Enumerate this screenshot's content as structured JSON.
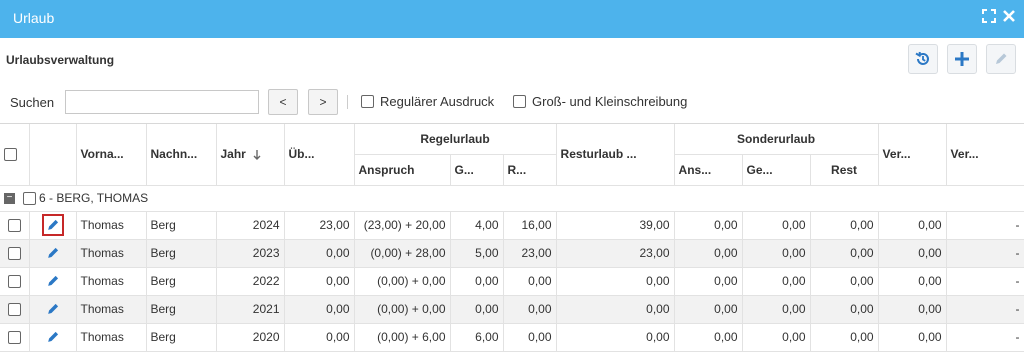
{
  "window": {
    "title": "Urlaub"
  },
  "section": {
    "title": "Urlaubsverwaltung"
  },
  "search": {
    "label": "Suchen",
    "value": "",
    "prev_label": "<",
    "next_label": ">"
  },
  "options": {
    "regular_print": "Regulärer Ausdruck",
    "case_sensitive": "Groß- und Kleinschreibung"
  },
  "columns": {
    "vorname": "Vorna...",
    "nachname": "Nachn...",
    "jahr": "Jahr",
    "ueb": "Üb...",
    "regelurlaub": "Regelurlaub",
    "anspruch": "Anspruch",
    "genommen": "G...",
    "rest": "R...",
    "resturlaub": "Resturlaub ...",
    "sonderurlaub": "Sonderurlaub",
    "s_anspruch": "Ans...",
    "s_genommen": "Ge...",
    "s_rest": "Rest",
    "ver1": "Ver...",
    "ver2": "Ver..."
  },
  "group": {
    "label": "6 - BERG, THOMAS"
  },
  "rows": [
    {
      "vorname": "Thomas",
      "nachname": "Berg",
      "jahr": "2024",
      "ueb": "23,00",
      "anspruch": "(23,00) + 20,00",
      "genommen": "4,00",
      "rest": "16,00",
      "resturlaub": "39,00",
      "s_anspruch": "0,00",
      "s_genommen": "0,00",
      "s_rest": "0,00",
      "ver1": "0,00",
      "ver2": "-"
    },
    {
      "vorname": "Thomas",
      "nachname": "Berg",
      "jahr": "2023",
      "ueb": "0,00",
      "anspruch": "(0,00) + 28,00",
      "genommen": "5,00",
      "rest": "23,00",
      "resturlaub": "23,00",
      "s_anspruch": "0,00",
      "s_genommen": "0,00",
      "s_rest": "0,00",
      "ver1": "0,00",
      "ver2": "-"
    },
    {
      "vorname": "Thomas",
      "nachname": "Berg",
      "jahr": "2022",
      "ueb": "0,00",
      "anspruch": "(0,00) + 0,00",
      "genommen": "0,00",
      "rest": "0,00",
      "resturlaub": "0,00",
      "s_anspruch": "0,00",
      "s_genommen": "0,00",
      "s_rest": "0,00",
      "ver1": "0,00",
      "ver2": "-"
    },
    {
      "vorname": "Thomas",
      "nachname": "Berg",
      "jahr": "2021",
      "ueb": "0,00",
      "anspruch": "(0,00) + 0,00",
      "genommen": "0,00",
      "rest": "0,00",
      "resturlaub": "0,00",
      "s_anspruch": "0,00",
      "s_genommen": "0,00",
      "s_rest": "0,00",
      "ver1": "0,00",
      "ver2": "-"
    },
    {
      "vorname": "Thomas",
      "nachname": "Berg",
      "jahr": "2020",
      "ueb": "0,00",
      "anspruch": "(0,00) + 6,00",
      "genommen": "6,00",
      "rest": "0,00",
      "resturlaub": "0,00",
      "s_anspruch": "0,00",
      "s_genommen": "0,00",
      "s_rest": "0,00",
      "ver1": "0,00",
      "ver2": "-"
    }
  ],
  "colors": {
    "titlebar": "#4db3ec",
    "accent_icon": "#2b78c5",
    "selected_border": "#c62828"
  }
}
